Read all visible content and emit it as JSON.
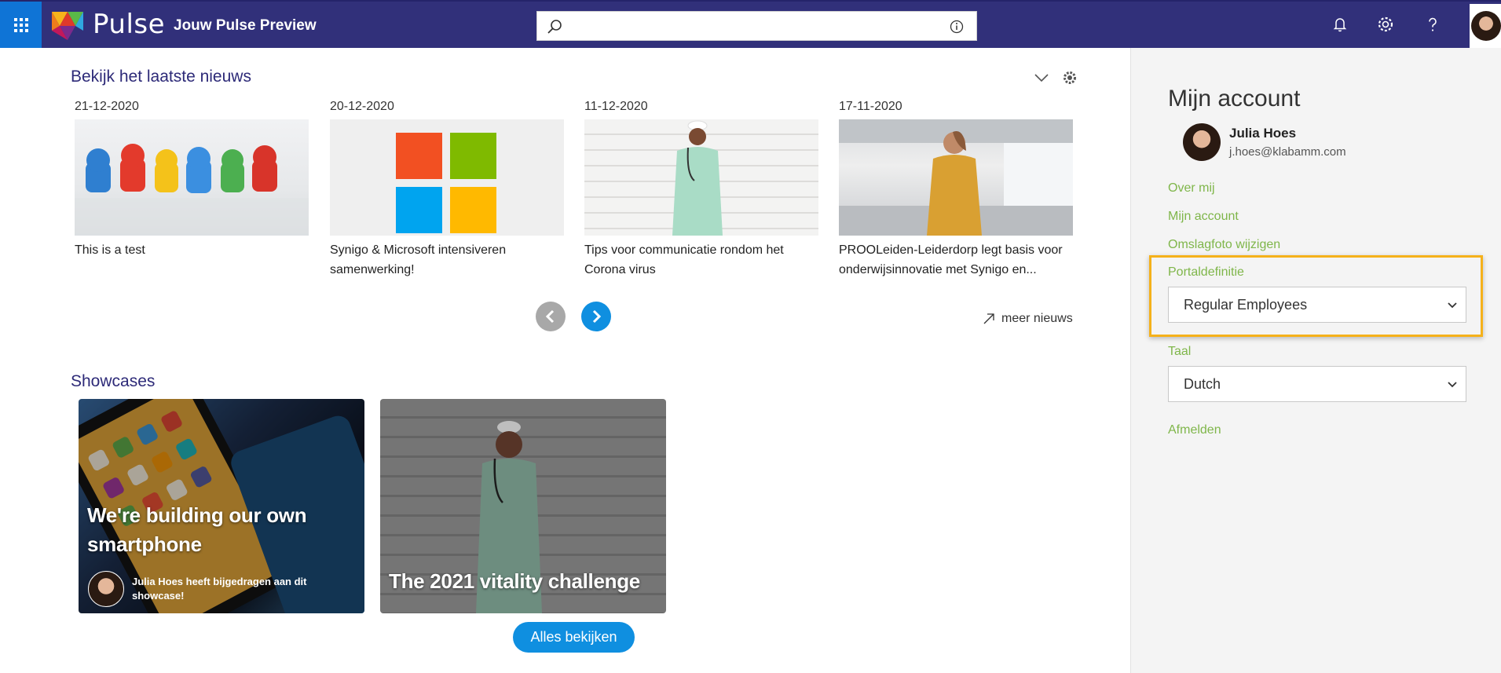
{
  "header": {
    "brand_name": "Pulse",
    "site_title": "Jouw Pulse Preview",
    "search": {
      "value": "",
      "placeholder": ""
    },
    "icons": [
      "waffle-icon",
      "search-icon",
      "info-icon",
      "bell-icon",
      "gear-icon",
      "help-icon",
      "avatar"
    ]
  },
  "news": {
    "title": "Bekijk het laatste nieuws",
    "items": [
      {
        "date": "21-12-2020",
        "caption": "This is a test"
      },
      {
        "date": "20-12-2020",
        "caption": "Synigo & Microsoft intensiveren samenwerking!"
      },
      {
        "date": "11-12-2020",
        "caption": "Tips voor communicatie rondom het Corona virus"
      },
      {
        "date": "17-11-2020",
        "caption": "PROOLeiden-Leiderdorp legt basis voor onderwijsinnovatie met Synigo en..."
      }
    ],
    "more_label": "meer nieuws"
  },
  "showcases": {
    "title": "Showcases",
    "items": [
      {
        "headline": "We're building our own smartphone",
        "contributor": "Julia Hoes heeft bijgedragen aan dit showcase!"
      },
      {
        "headline": "The 2021 vitality challenge"
      }
    ],
    "all_label": "Alles bekijken"
  },
  "account": {
    "title": "Mijn account",
    "name": "Julia Hoes",
    "email": "j.hoes@klabamm.com",
    "links": {
      "about": "Over mij",
      "account": "Mijn account",
      "cover": "Omslagfoto wijzigen",
      "logout": "Afmelden"
    },
    "portal_label": "Portaldefinitie",
    "portal_value": "Regular Employees",
    "language_label": "Taal",
    "language_value": "Dutch"
  },
  "colors": {
    "topbar": "#31307a",
    "accent_blue": "#0f8fe0",
    "link_green": "#7fb64a",
    "highlight": "#f5b11a",
    "heading": "#2d2a78"
  }
}
